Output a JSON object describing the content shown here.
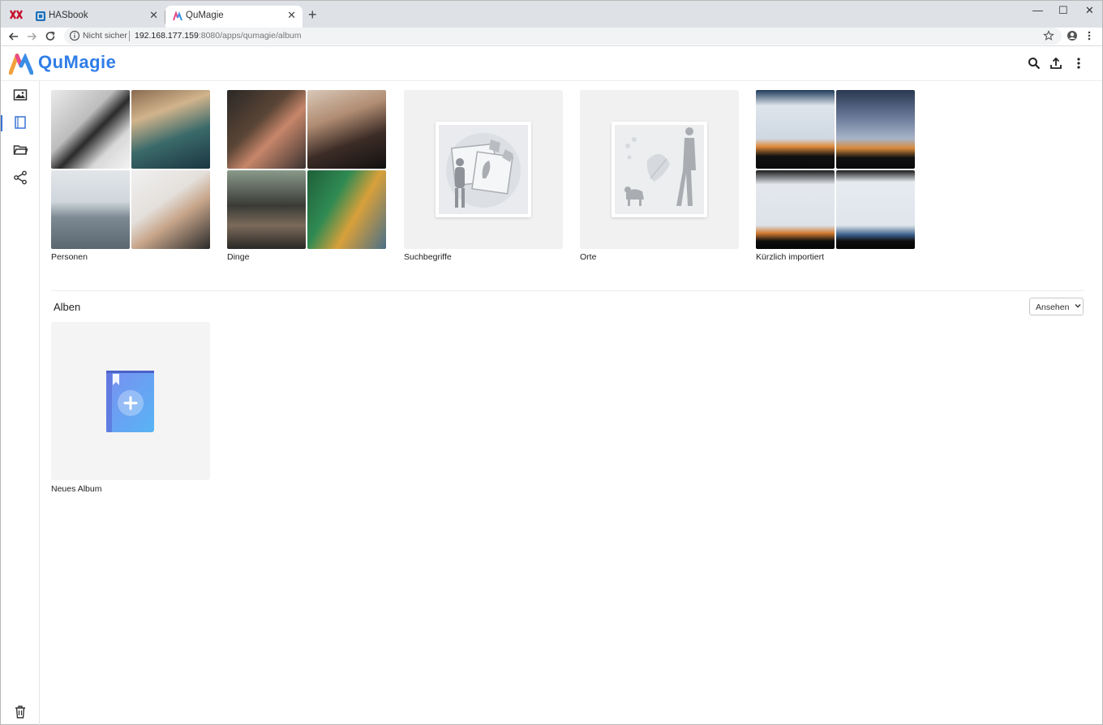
{
  "browser": {
    "tabs": [
      {
        "title": "HASbook"
      },
      {
        "title": "QuMagie"
      }
    ],
    "omnibox": {
      "security_label": "Nicht sicher",
      "url_host": "192.168.177.159",
      "url_rest": ":8080/apps/qumagie/album"
    },
    "window_controls": [
      "—",
      "☐",
      "✕"
    ]
  },
  "app": {
    "name": "QuMagie",
    "accent": "#2f7de8"
  },
  "categories": [
    {
      "label": "Personen"
    },
    {
      "label": "Dinge"
    },
    {
      "label": "Suchbegriffe"
    },
    {
      "label": "Orte"
    },
    {
      "label": "Kürzlich importiert"
    }
  ],
  "albums": {
    "section_title": "Alben",
    "view_button": "Ansehen",
    "new_album_label": "Neues Album"
  }
}
